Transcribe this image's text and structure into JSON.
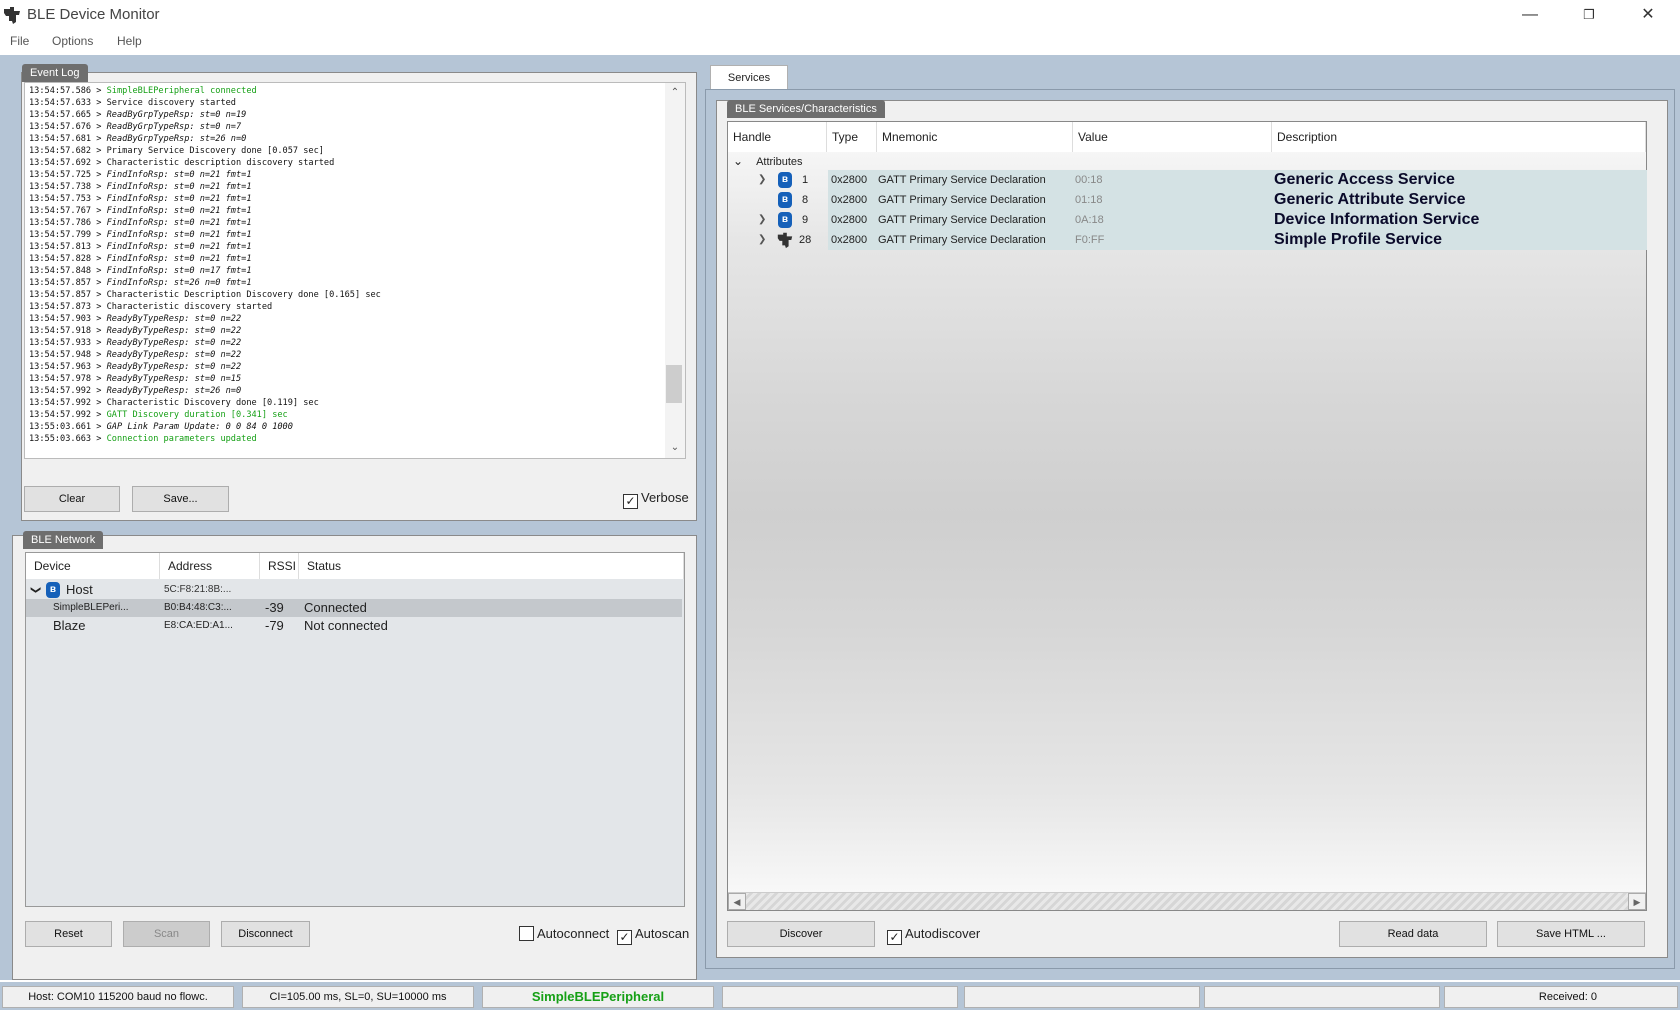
{
  "window": {
    "title": "BLE Device Monitor",
    "minimize_glyph": "—",
    "restore_glyph": "❐",
    "close_glyph": "✕"
  },
  "menu": [
    "File",
    "Options",
    "Help"
  ],
  "event_log": {
    "tab_label": "Event Log",
    "lines": [
      {
        "time": "13:54:57.586",
        "msg": "SimpleBLEPeripheral connected",
        "style": "green"
      },
      {
        "time": "13:54:57.633",
        "msg": "Service discovery started",
        "style": "normal"
      },
      {
        "time": "13:54:57.665",
        "msg": "ReadByGrpTypeRsp: st=0 n=19",
        "style": "italic"
      },
      {
        "time": "13:54:57.676",
        "msg": "ReadByGrpTypeRsp: st=0 n=7",
        "style": "italic"
      },
      {
        "time": "13:54:57.681",
        "msg": "ReadByGrpTypeRsp: st=26 n=0",
        "style": "italic"
      },
      {
        "time": "13:54:57.682",
        "msg": "Primary Service Discovery done [0.057 sec]",
        "style": "normal"
      },
      {
        "time": "13:54:57.692",
        "msg": "Characteristic description discovery started",
        "style": "normal"
      },
      {
        "time": "13:54:57.725",
        "msg": "FindInfoRsp: st=0 n=21 fmt=1",
        "style": "italic"
      },
      {
        "time": "13:54:57.738",
        "msg": "FindInfoRsp: st=0 n=21 fmt=1",
        "style": "italic"
      },
      {
        "time": "13:54:57.753",
        "msg": "FindInfoRsp: st=0 n=21 fmt=1",
        "style": "italic"
      },
      {
        "time": "13:54:57.767",
        "msg": "FindInfoRsp: st=0 n=21 fmt=1",
        "style": "italic"
      },
      {
        "time": "13:54:57.786",
        "msg": "FindInfoRsp: st=0 n=21 fmt=1",
        "style": "italic"
      },
      {
        "time": "13:54:57.799",
        "msg": "FindInfoRsp: st=0 n=21 fmt=1",
        "style": "italic"
      },
      {
        "time": "13:54:57.813",
        "msg": "FindInfoRsp: st=0 n=21 fmt=1",
        "style": "italic"
      },
      {
        "time": "13:54:57.828",
        "msg": "FindInfoRsp: st=0 n=21 fmt=1",
        "style": "italic"
      },
      {
        "time": "13:54:57.848",
        "msg": "FindInfoRsp: st=0 n=17 fmt=1",
        "style": "italic"
      },
      {
        "time": "13:54:57.857",
        "msg": "FindInfoRsp: st=26 n=0 fmt=1",
        "style": "italic"
      },
      {
        "time": "13:54:57.857",
        "msg": "Characteristic Description Discovery done [0.165] sec",
        "style": "normal"
      },
      {
        "time": "13:54:57.873",
        "msg": "Characteristic discovery started",
        "style": "normal"
      },
      {
        "time": "13:54:57.903",
        "msg": "ReadyByTypeResp: st=0 n=22",
        "style": "italic"
      },
      {
        "time": "13:54:57.918",
        "msg": "ReadyByTypeResp: st=0 n=22",
        "style": "italic"
      },
      {
        "time": "13:54:57.933",
        "msg": "ReadyByTypeResp: st=0 n=22",
        "style": "italic"
      },
      {
        "time": "13:54:57.948",
        "msg": "ReadyByTypeResp: st=0 n=22",
        "style": "italic"
      },
      {
        "time": "13:54:57.963",
        "msg": "ReadyByTypeResp: st=0 n=22",
        "style": "italic"
      },
      {
        "time": "13:54:57.978",
        "msg": "ReadyByTypeResp: st=0 n=15",
        "style": "italic"
      },
      {
        "time": "13:54:57.992",
        "msg": "ReadyByTypeResp: st=26 n=0",
        "style": "italic"
      },
      {
        "time": "13:54:57.992",
        "msg": "Characteristic Discovery done [0.119] sec",
        "style": "normal"
      },
      {
        "time": "13:54:57.992",
        "msg": "GATT Discovery duration [0.341] sec",
        "style": "green"
      },
      {
        "time": "13:55:03.661",
        "msg": "GAP Link Param Update: 0 0 84 0 1000",
        "style": "italic"
      },
      {
        "time": "13:55:03.663",
        "msg": "Connection parameters updated",
        "style": "green"
      }
    ],
    "clear_label": "Clear",
    "save_label": "Save...",
    "verbose_label": "Verbose",
    "verbose_checked": true,
    "scroll_up_glyph": "⌃",
    "scroll_down_glyph": "⌄"
  },
  "network": {
    "tab_label": "BLE Network",
    "columns": [
      "Device",
      "Address",
      "RSSI",
      "Status"
    ],
    "host": {
      "name": "Host",
      "address": "5C:F8:21:8B:...",
      "rssi": "",
      "status": "",
      "expand_glyph": "❯",
      "bt_glyph": "ʙ"
    },
    "devices": [
      {
        "name": "SimpleBLEPeri...",
        "address": "B0:B4:48:C3:...",
        "rssi": "-39",
        "status": "Connected",
        "selected": true
      },
      {
        "name": "Blaze",
        "address": "E8:CA:ED:A1...",
        "rssi": "-79",
        "status": "Not connected",
        "selected": false
      }
    ],
    "reset_label": "Reset",
    "scan_label": "Scan",
    "disconnect_label": "Disconnect",
    "autoconnect_label": "Autoconnect",
    "autoconnect_checked": false,
    "autoscan_label": "Autoscan",
    "autoscan_checked": true
  },
  "services": {
    "tab_label": "Services",
    "inner_tab_label": "BLE Services/Characteristics",
    "columns": [
      "Handle",
      "Type",
      "Mnemonic",
      "Value",
      "Description"
    ],
    "root_label": "Attributes",
    "root_glyph": "⌄",
    "rows": [
      {
        "handle": "1",
        "type": "0x2800",
        "mnemonic": "GATT Primary Service Declaration",
        "value": "00:18",
        "description": "Generic Access Service",
        "expandable": true,
        "icon": "bluetooth-icon",
        "glyph": "ʙ"
      },
      {
        "handle": "8",
        "type": "0x2800",
        "mnemonic": "GATT Primary Service Declaration",
        "value": "01:18",
        "description": "Generic Attribute Service",
        "expandable": false,
        "icon": "bluetooth-icon",
        "glyph": "ʙ"
      },
      {
        "handle": "9",
        "type": "0x2800",
        "mnemonic": "GATT Primary Service Declaration",
        "value": "0A:18",
        "description": "Device Information Service",
        "expandable": true,
        "icon": "bluetooth-icon",
        "glyph": "ʙ"
      },
      {
        "handle": "28",
        "type": "0x2800",
        "mnemonic": "GATT Primary Service Declaration",
        "value": "F0:FF",
        "description": "Simple Profile Service",
        "expandable": true,
        "icon": "ti-logo-icon",
        "glyph": "ʙ"
      }
    ],
    "row_expand_glyph": "❯",
    "scroll_left_glyph": "◀",
    "scroll_right_glyph": "▶",
    "discover_label": "Discover",
    "autodiscover_label": "Autodiscover",
    "autodiscover_checked": true,
    "read_data_label": "Read data",
    "save_html_label": "Save HTML ..."
  },
  "status_bar": {
    "host": "Host: COM10 115200 baud no flowc.",
    "conn_params": "CI=105.00 ms, SL=0, SU=10000 ms",
    "device": "SimpleBLEPeripheral",
    "empty1": "",
    "empty2": "",
    "empty3": "",
    "received": "Received: 0"
  },
  "colors": {
    "log_green": "#16a016",
    "device_green": "#16a016",
    "bluetooth_blue": "#1560b9",
    "row_highlight": "#d4e2e4"
  },
  "checkmark": "✓"
}
